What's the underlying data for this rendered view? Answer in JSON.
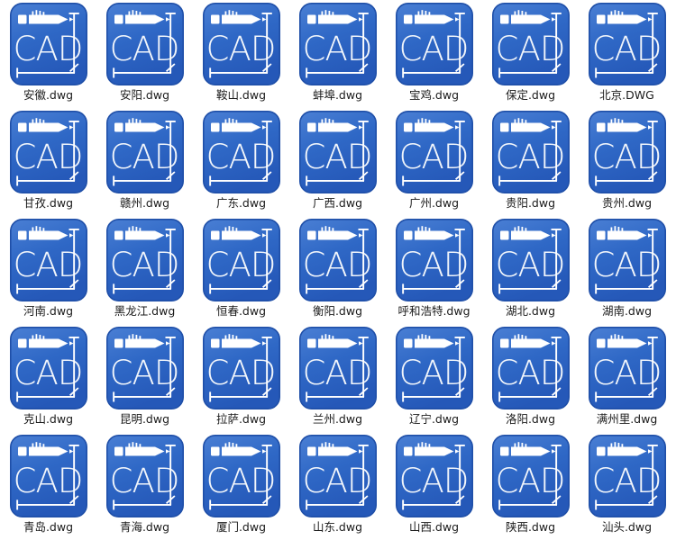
{
  "view": {
    "background_color": "#ffffff",
    "columns": 7,
    "rows": 5,
    "label_color": "#1a1a1a"
  },
  "icon": {
    "semantic_name": "cad-dwg-file-icon",
    "text": "CAD",
    "badge_text_color": "#f2f6fb",
    "gradient_top": "#4a7fd4",
    "gradient_mid": "#2f68c6",
    "gradient_bottom": "#2558b8",
    "border_color": "#1f4fa8",
    "accent_color": "#ffffff",
    "parts": [
      "pencil-glyph",
      "cad-wordmark",
      "vertical-dimension-line",
      "horizontal-dimension-line",
      "diagonal-tick-mark"
    ]
  },
  "files": [
    {
      "name": "安徽.dwg"
    },
    {
      "name": "安阳.dwg"
    },
    {
      "name": "鞍山.dwg"
    },
    {
      "name": "蚌埠.dwg"
    },
    {
      "name": "宝鸡.dwg"
    },
    {
      "name": "保定.dwg"
    },
    {
      "name": "北京.DWG"
    },
    {
      "name": "甘孜.dwg"
    },
    {
      "name": "赣州.dwg"
    },
    {
      "name": "广东.dwg"
    },
    {
      "name": "广西.dwg"
    },
    {
      "name": "广州.dwg"
    },
    {
      "name": "贵阳.dwg"
    },
    {
      "name": "贵州.dwg"
    },
    {
      "name": "河南.dwg"
    },
    {
      "name": "黑龙江.dwg"
    },
    {
      "name": "恒春.dwg"
    },
    {
      "name": "衡阳.dwg"
    },
    {
      "name": "呼和浩特.dwg"
    },
    {
      "name": "湖北.dwg"
    },
    {
      "name": "湖南.dwg"
    },
    {
      "name": "克山.dwg"
    },
    {
      "name": "昆明.dwg"
    },
    {
      "name": "拉萨.dwg"
    },
    {
      "name": "兰州.dwg"
    },
    {
      "name": "辽宁.dwg"
    },
    {
      "name": "洛阳.dwg"
    },
    {
      "name": "满州里.dwg"
    },
    {
      "name": "青岛.dwg"
    },
    {
      "name": "青海.dwg"
    },
    {
      "name": "厦门.dwg"
    },
    {
      "name": "山东.dwg"
    },
    {
      "name": "山西.dwg"
    },
    {
      "name": "陕西.dwg"
    },
    {
      "name": "汕头.dwg"
    }
  ]
}
